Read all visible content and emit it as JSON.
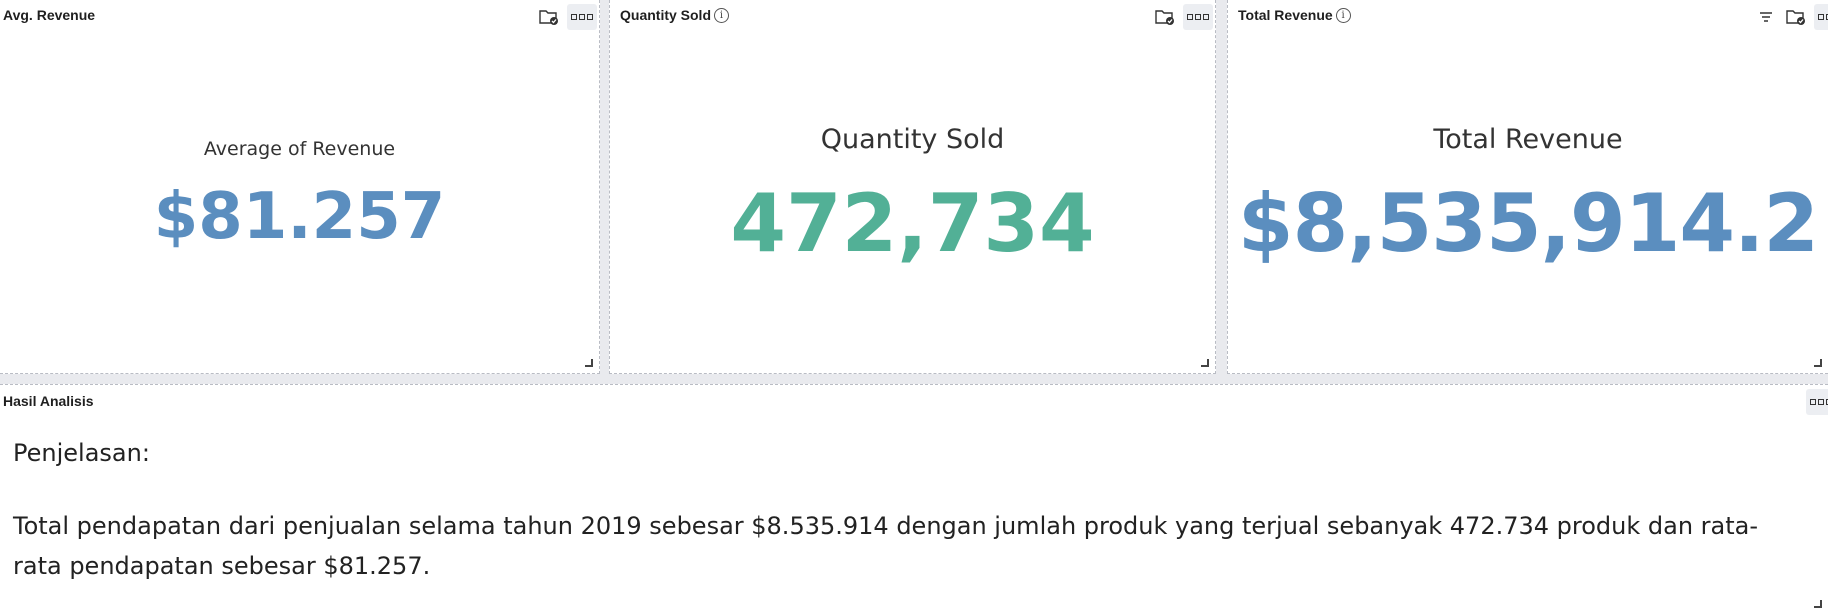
{
  "panels": {
    "avg_revenue": {
      "title": "Avg. Revenue",
      "label": "Average of Revenue",
      "value": "$81.257",
      "value_color": "#5b8ebf"
    },
    "quantity_sold": {
      "title": "Quantity Sold",
      "label": "Quantity Sold",
      "value": "472,734",
      "value_color": "#52b096"
    },
    "total_revenue": {
      "title": "Total Revenue",
      "label": "Total Revenue",
      "value": "$8,535,914.2",
      "value_color": "#5b8ebf"
    },
    "analysis": {
      "title": "Hasil Analisis",
      "heading": "Penjelasan:",
      "paragraph": "Total pendapatan dari penjualan selama tahun 2019 sebesar $8.535.914 dengan jumlah produk yang terjual sebanyak 472.734 produk dan rata-rata pendapatan sebesar $81.257."
    }
  },
  "icons": {
    "info": "info-icon",
    "folder_check": "folder-check-icon",
    "filter": "filter-icon",
    "more": "more-options-icon",
    "resize": "resize-handle-icon"
  }
}
